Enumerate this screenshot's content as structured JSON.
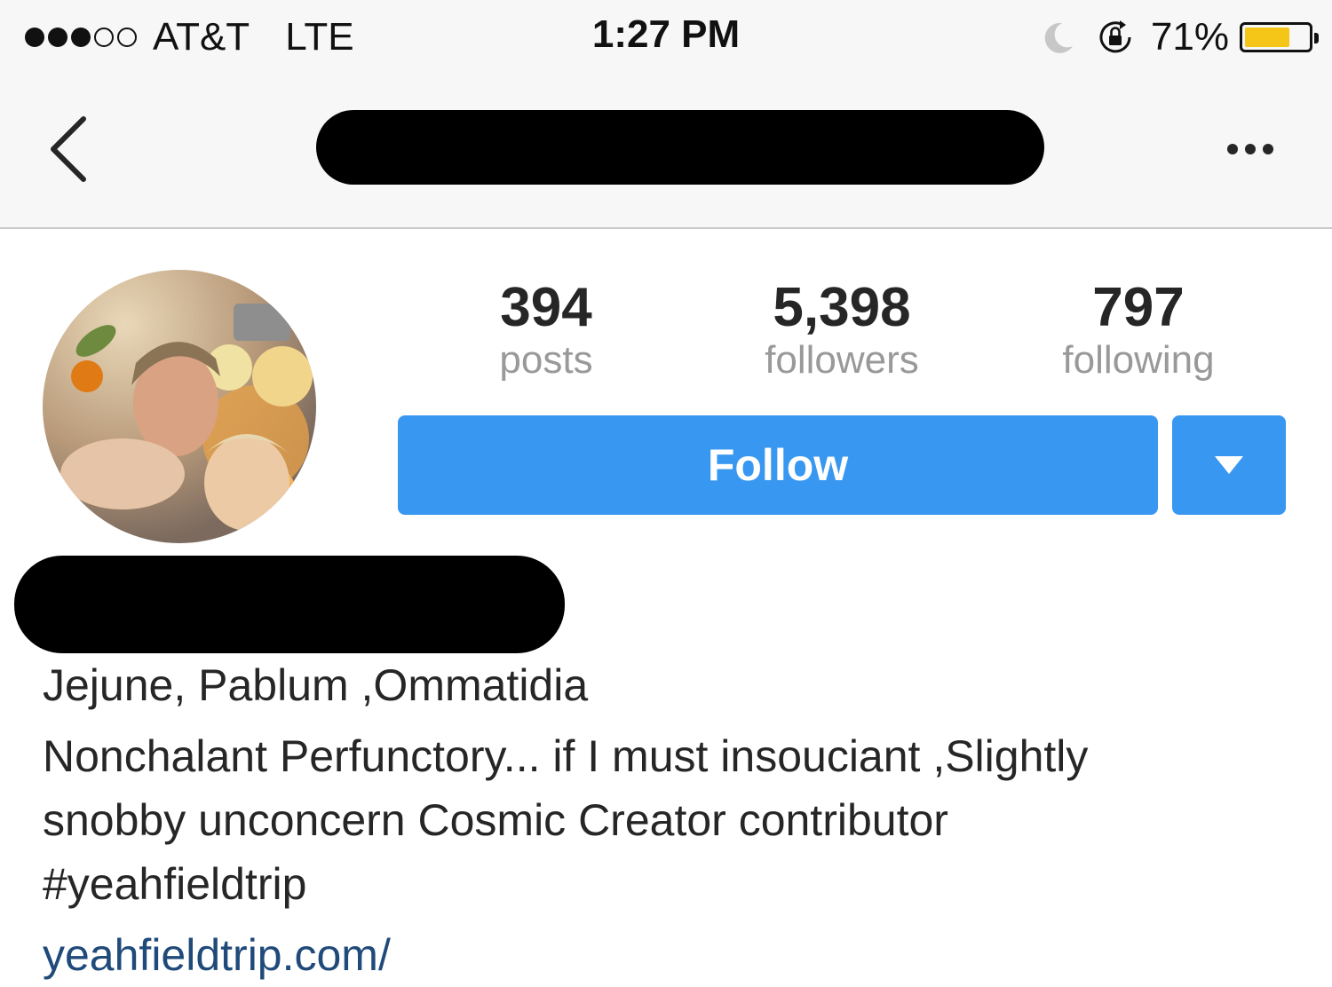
{
  "status_bar": {
    "carrier": "AT&T",
    "network": "LTE",
    "time": "1:27 PM",
    "battery_percent": "71%",
    "battery_level": 0.71,
    "signal_filled": 3,
    "signal_total": 5,
    "icons": [
      "moon-icon",
      "rotation-lock-icon",
      "battery-icon"
    ]
  },
  "nav": {
    "back_icon": "chevron-left-icon",
    "more_icon": "more-horizontal-icon"
  },
  "profile": {
    "stats": [
      {
        "count": "394",
        "label": "posts"
      },
      {
        "count": "5,398",
        "label": "followers"
      },
      {
        "count": "797",
        "label": "following"
      }
    ],
    "follow_label": "Follow",
    "dropdown_icon": "caret-down-icon",
    "bio": [
      "Jejune, Pablum ,Ommatidia",
      "Nonchalant Perfunctory... if I must insouciant ,Slightly",
      "snobby unconcern Cosmic Creator contributor",
      "#yeahfieldtrip"
    ],
    "website": "yeahfieldtrip.com/"
  },
  "colors": {
    "accent": "#3897f0",
    "link": "#1f4a7a",
    "muted_label": "#999999",
    "text": "#262626",
    "bar_background": "#f7f7f7",
    "battery_fill": "#f5c518"
  }
}
